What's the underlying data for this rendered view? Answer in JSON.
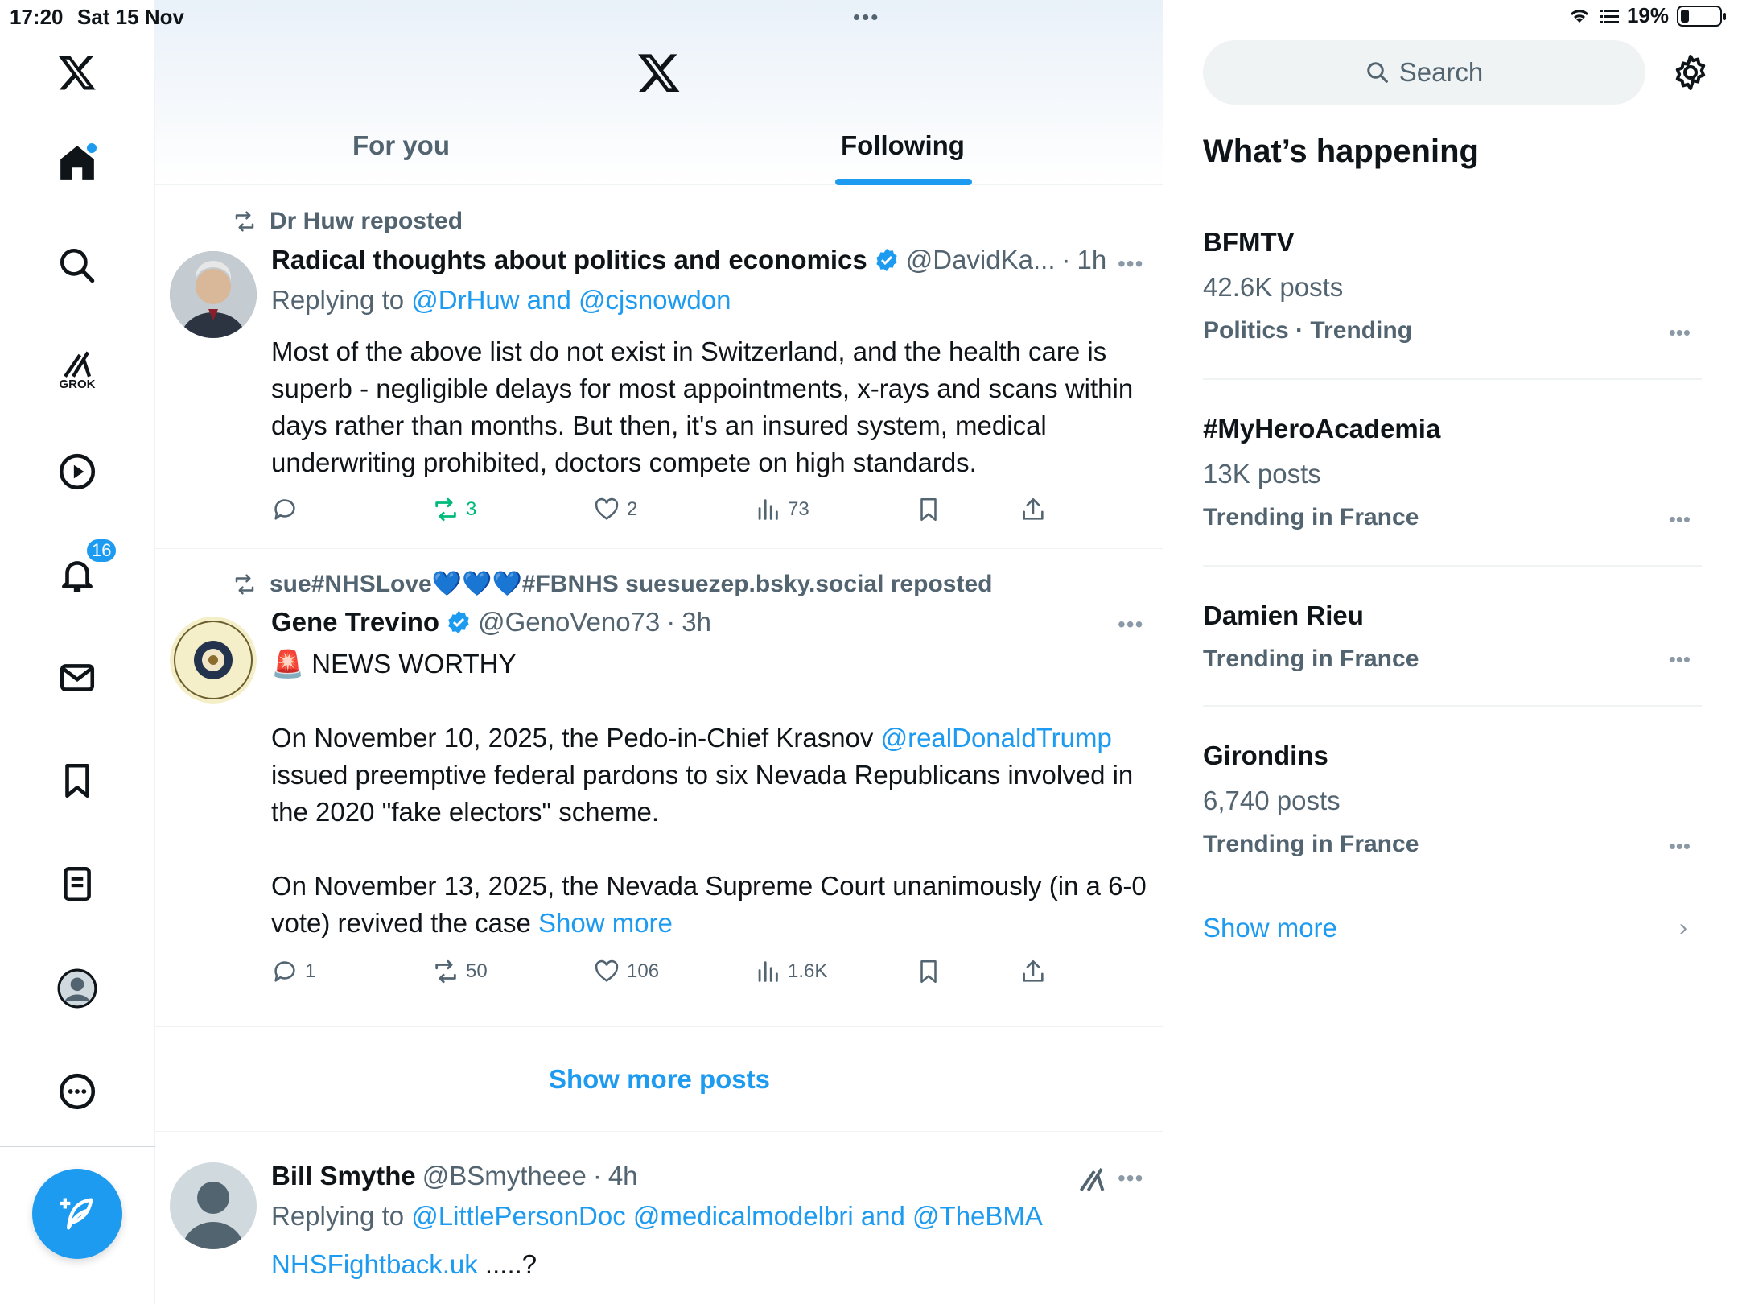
{
  "status_bar": {
    "time": "17:20",
    "date": "Sat 15 Nov",
    "battery": "19%",
    "battery_level": 0.19
  },
  "nav": {
    "notifications_badge": "16",
    "grok_label": "GROK"
  },
  "header": {
    "tabs": [
      {
        "label": "For you",
        "active": false
      },
      {
        "label": "Following",
        "active": true
      }
    ]
  },
  "posts": [
    {
      "repost_by": "Dr Huw reposted",
      "author": "Radical thoughts about politics and economics",
      "handle": "@DavidKa...",
      "time": "1h",
      "replying_prefix": "Replying to ",
      "replying_to": "@DrHuw and @cjsnowdon",
      "text": "Most of the above list do not exist in Switzerland, and the health care is superb - negligible delays for most appointments, x-rays and scans within days rather than months. But then, it's an insured system, medical underwriting prohibited, doctors compete on high standards.",
      "replies": "",
      "reposts": "3",
      "likes": "2",
      "views": "73"
    },
    {
      "repost_by": "sue#NHSLove💙💙💙#FBNHS suesuezep.bsky.social reposted",
      "author": "Gene Trevino",
      "handle": "@GenoVeno73",
      "time": "3h",
      "line1": "🚨 NEWS WORTHY",
      "para2_a": "On November 10, 2025, the Pedo-in-Chief Krasnov ",
      "para2_link": "@realDonaldTrump",
      "para2_b": " issued preemptive federal pardons to six Nevada Republicans involved in the 2020 \"fake electors\" scheme.",
      "para3": "On November 13, 2025, the Nevada Supreme Court unanimously (in a 6-0 vote) revived the case ",
      "show_more": "Show more",
      "replies": "1",
      "reposts": "50",
      "likes": "106",
      "views": "1.6K"
    },
    {
      "author": "Bill Smythe",
      "handle": "@BSmytheee",
      "time": "4h",
      "replying_prefix": "Replying to ",
      "replying_to": "@LittlePersonDoc @medicalmodelbri and @TheBMA",
      "text_link": "NHSFightback.uk",
      "text_rest": " .....?"
    }
  ],
  "show_more_posts": "Show more posts",
  "sidebar": {
    "search_placeholder": "Search",
    "title": "What’s happening",
    "trends": [
      {
        "name": "BFMTV",
        "posts": "42.6K posts",
        "meta": "Politics · Trending"
      },
      {
        "name": "#MyHeroAcademia",
        "posts": "13K posts",
        "meta": "Trending in France"
      },
      {
        "name": "Damien Rieu",
        "posts": "",
        "meta": "Trending in France"
      },
      {
        "name": "Girondins",
        "posts": "6,740 posts",
        "meta": "Trending in France"
      }
    ],
    "show_more": "Show more"
  },
  "colors": {
    "accent": "#1d9bf0",
    "repost_green": "#00ba7c",
    "muted": "#536471"
  },
  "icons": [
    "x-logo-icon",
    "home-icon",
    "search-icon",
    "grok-icon",
    "video-icon",
    "bell-icon",
    "mail-icon",
    "bookmark-icon",
    "list-icon",
    "profile-icon",
    "more-icon",
    "compose-icon",
    "repost-icon",
    "reply-icon",
    "like-icon",
    "views-icon",
    "share-icon",
    "verified-badge-icon",
    "gear-icon",
    "grok-inline-icon"
  ]
}
